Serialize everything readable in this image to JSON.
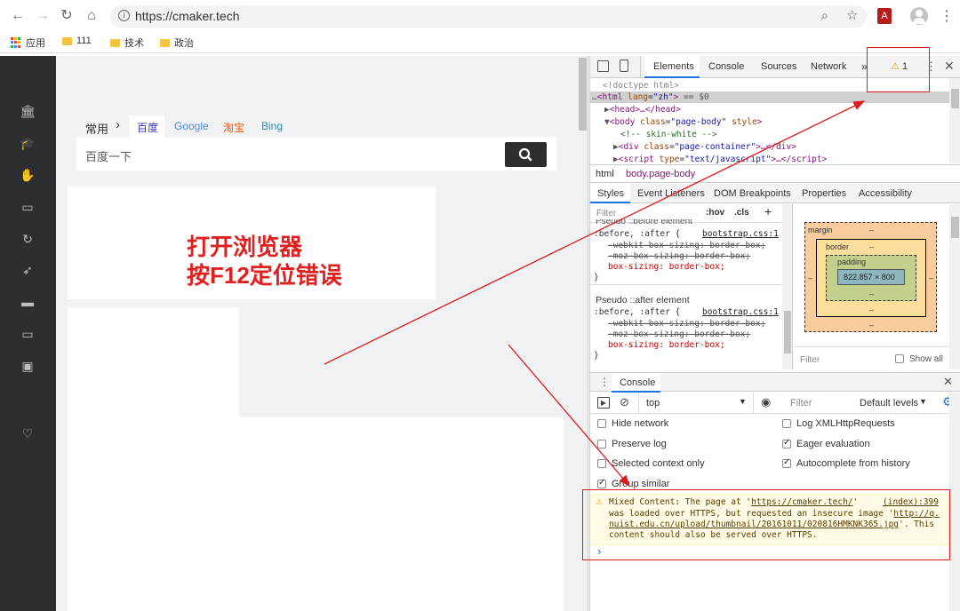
{
  "browser": {
    "url": "https://cmaker.tech",
    "bookmarks": [
      {
        "label": "应用",
        "type": "apps"
      },
      {
        "label": "111",
        "type": "folder"
      },
      {
        "label": "技术",
        "type": "folder"
      },
      {
        "label": "政治",
        "type": "folder"
      }
    ]
  },
  "page": {
    "search_tabs": {
      "common": "常用",
      "arrow": "›",
      "items": [
        {
          "label": "百度",
          "color": "#3333cc"
        },
        {
          "label": "Google",
          "color": "#4a8be0"
        },
        {
          "label": "淘宝",
          "color": "#ff5000"
        },
        {
          "label": "Bing",
          "color": "#2a8bb5"
        }
      ]
    },
    "search_placeholder": "百度一下",
    "annotation_lines": [
      "打开浏览器",
      "按F12定位错误"
    ]
  },
  "devtools": {
    "tabs": [
      "Elements",
      "Console",
      "Sources",
      "Network"
    ],
    "more": "»",
    "warning_count": "1",
    "dom": {
      "doctype": "<!doctype html>",
      "html_line": {
        "tag": "html",
        "attr": "lang",
        "val": "\"zh\"",
        "suffix": " == $0"
      },
      "head_line": "<head>…</head>",
      "body_line": {
        "attr1": "class",
        "val1": "\"page-body\"",
        "attr2": "style"
      },
      "comment": "<!-- skin-white -->",
      "div_line": {
        "attr": "class",
        "val": "\"page-container\""
      },
      "script_line": {
        "attr": "type",
        "val": "\"text/javascript\""
      }
    },
    "breadcrumb": [
      "html",
      "body.page-body"
    ],
    "style_tabs": [
      "Styles",
      "Event Listeners",
      "DOM Breakpoints",
      "Properties",
      "Accessibility"
    ],
    "styles": {
      "filter_placeholder": "Filter",
      "hov": ":hov",
      "cls": ".cls",
      "plus": "+",
      "pseudo_before_header": "Pseudo ::before element",
      "pseudo_after_header": "Pseudo ::after element",
      "selector": ":before, :after {",
      "source": "bootstrap.css:1",
      "decl1": "-webkit-box-sizing: border-box;",
      "decl2": "-moz-box-sizing: border-box;",
      "decl3": "box-sizing: border-box;",
      "close": "}"
    },
    "box_model": {
      "margin_label": "margin",
      "border_label": "border",
      "padding_label": "padding",
      "dash": "–",
      "content": "822.857 × 800",
      "filter_placeholder": "Filter",
      "show_all": "Show all"
    },
    "drawer": {
      "title": "Console",
      "context": "top",
      "filter_placeholder": "Filter",
      "levels": "Default levels",
      "options_left": [
        {
          "label": "Hide network",
          "checked": false
        },
        {
          "label": "Preserve log",
          "checked": false
        },
        {
          "label": "Selected context only",
          "checked": false
        },
        {
          "label": "Group similar",
          "checked": true
        }
      ],
      "options_right": [
        {
          "label": "Log XMLHttpRequests",
          "checked": false
        },
        {
          "label": "Eager evaluation",
          "checked": true
        },
        {
          "label": "Autocomplete from history",
          "checked": true
        }
      ],
      "message": {
        "line1": "Mixed Content: The page at '",
        "page_link": "https://cmaker.tech/",
        "line1_end": "'",
        "source": "(index):399",
        "line2_start": "was loaded over HTTPS, but requested an insecure image '",
        "image_link_1": "http://q.",
        "image_link_2": "nuist.edu.cn/upload/thumbnail/20161011/020816HMKNK365.jpg",
        "line3_end": "'. This",
        "line4": "content should also be served over HTTPS."
      },
      "prompt": "›"
    }
  },
  "colors": {
    "annotation_red": "#e02020",
    "warning_bg": "#fffbe5",
    "devtools_blue": "#1a73e8"
  }
}
